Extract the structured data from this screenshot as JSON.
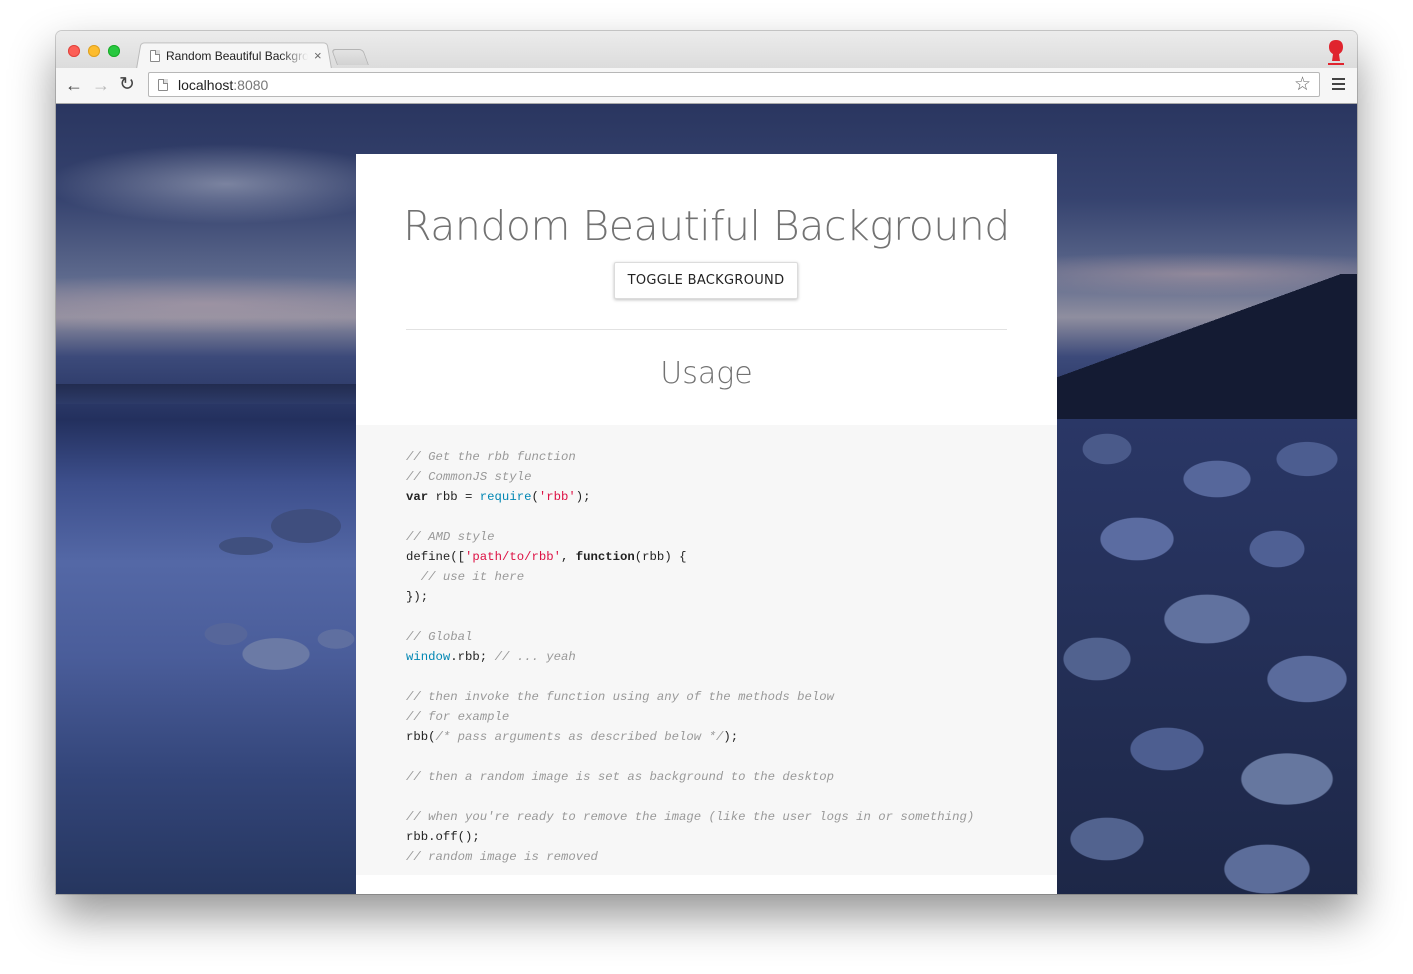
{
  "browser": {
    "tab_title": "Random Beautiful Backgro",
    "tab_close": "×",
    "url_host": "localhost",
    "url_port": ":8080",
    "nav_back": "←",
    "nav_forward": "→",
    "nav_reload": "↻",
    "star": "☆"
  },
  "page": {
    "title": "Random Beautiful Background",
    "toggle_label": "TOGGLE BACKGROUND",
    "usage_heading": "Usage"
  },
  "code": {
    "l1": "// Get the rbb function",
    "l2": "// CommonJS style",
    "l3_kw": "var",
    "l3_mid": " rbb = ",
    "l3_fn": "require",
    "l3_open": "(",
    "l3_str": "'rbb'",
    "l3_close": ");",
    "l5": "// AMD style",
    "l6_a": "define([",
    "l6_str": "'path/to/rbb'",
    "l6_b": ", ",
    "l6_kw": "function",
    "l6_c": "(rbb) {",
    "l7": "  // use it here",
    "l8": "});",
    "l10": "// Global",
    "l11_obj": "window",
    "l11_mid": ".rbb; ",
    "l11_c": "// ... yeah",
    "l13": "// then invoke the function using any of the methods below",
    "l14": "// for example",
    "l15_a": "rbb(",
    "l15_c": "/* pass arguments as described below */",
    "l15_b": ");",
    "l17": "// then a random image is set as background to the desktop",
    "l19": "// when you're ready to remove the image (like the user logs in or something)",
    "l20": "rbb.off();",
    "l21": "// random image is removed"
  },
  "colors": {
    "comment": "#999999",
    "string": "#dd1144",
    "builtin": "#0086b3",
    "heading": "#727272"
  }
}
